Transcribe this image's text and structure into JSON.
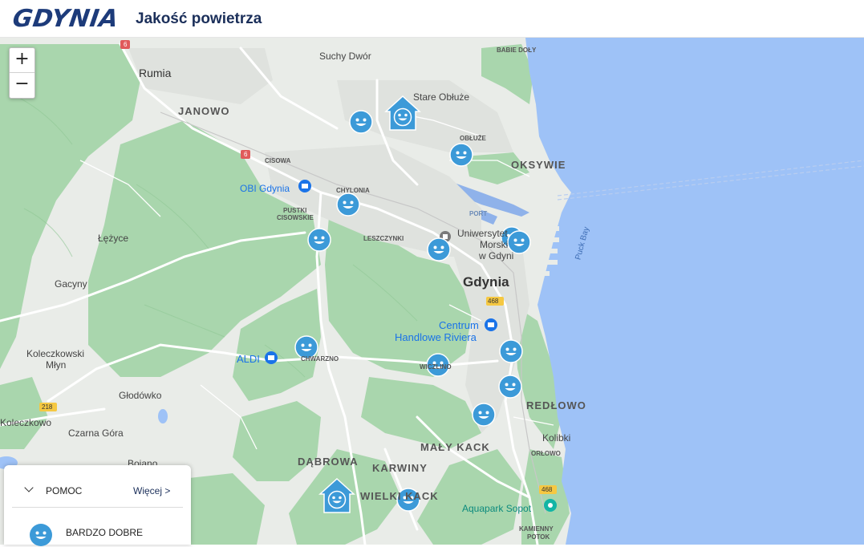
{
  "header": {
    "logo_text": "GDYNIA",
    "title": "Jakość powietrza"
  },
  "zoom": {
    "in_label": "+",
    "out_label": "−"
  },
  "panel": {
    "title": "POMOC",
    "more_label": "Więcej >",
    "legend_label": "BARDZO DOBRE"
  },
  "colors": {
    "water": "#9ec2f7",
    "forest": "#a9d6ad",
    "urban": "#e9ece8",
    "marker": "#3c9ad8",
    "brand": "#1d3b7a"
  },
  "map_labels": {
    "rumia": "Rumia",
    "suchy_dwor": "Suchy Dwór",
    "babie_doly": "BABIE DOŁY",
    "janowo": "JANOWO",
    "stare_obluze": "Stare Obłuże",
    "obluze": "OBŁUŻE",
    "oksywie": "OKSYWIE",
    "cisowa": "CISOWA",
    "obi": "OBI Gdynia",
    "chylonia": "CHYLONIA",
    "pustki": "PUSTKI",
    "cisowskie": "CISOWSKIE",
    "port": "PORT",
    "uniwersytet": "Uniwersytet",
    "morski": "Morski",
    "w_gdyni": "w Gdyni",
    "puck_bay": "Puck Bay",
    "lezyce": "Łężyce",
    "leszczynki": "LESZCZYNKI",
    "gacyny": "Gacyny",
    "gdynia": "Gdynia",
    "road_468": "468",
    "centrum": "Centrum",
    "riviera": "Handlowe Riviera",
    "koleczkowski": "Koleczkowski",
    "mlyn": "Młyn",
    "aldi": "ALDI",
    "chwarzno": "CHWARZNO",
    "wiczlino": "WICZLINO",
    "glodowko": "Głodówko",
    "road_218": "218",
    "redlowo": "REDŁOWO",
    "koleczkowo": "Koleczkowo",
    "czarna_gora": "Czarna Góra",
    "kolibki": "Kolibki",
    "orlowo": "ORŁOWO",
    "maly_kack": "MAŁY KACK",
    "dabrowa": "DĄBROWA",
    "karwiny": "KARWINY",
    "bojano": "Bojano",
    "wielki_kack": "WIELKI KACK",
    "aquapark": "Aquapark Sopot",
    "kamienny": "KAMIENNY",
    "potok": "POTOK",
    "road_6": "6",
    "road_6b": "6",
    "road_468b": "468"
  },
  "stations": [
    {
      "id": "s1",
      "type": "face"
    },
    {
      "id": "s2",
      "type": "house"
    },
    {
      "id": "s3",
      "type": "face"
    },
    {
      "id": "s4",
      "type": "face"
    },
    {
      "id": "s5",
      "type": "face"
    },
    {
      "id": "s6",
      "type": "face"
    },
    {
      "id": "s7",
      "type": "face"
    },
    {
      "id": "s8",
      "type": "face"
    },
    {
      "id": "s9",
      "type": "face"
    },
    {
      "id": "s10",
      "type": "face"
    },
    {
      "id": "s11",
      "type": "face"
    },
    {
      "id": "s12",
      "type": "face"
    },
    {
      "id": "s13",
      "type": "house"
    },
    {
      "id": "s14",
      "type": "face"
    }
  ]
}
